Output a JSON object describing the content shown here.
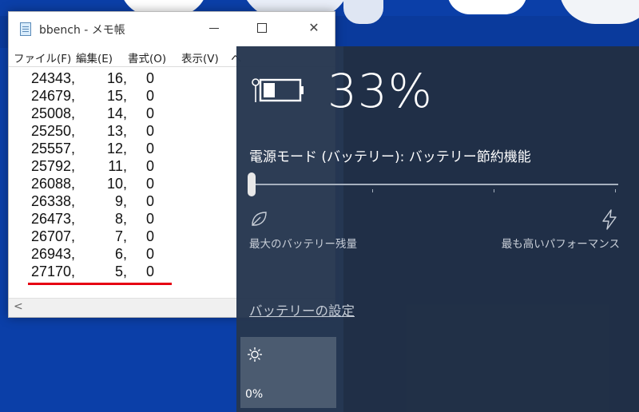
{
  "notepad": {
    "title": "bbench - メモ帳",
    "menu": [
      "ファイル(F)",
      "編集(E)",
      "書式(O)",
      "表示(V)",
      "ヘ"
    ],
    "rows": [
      [
        "24343,",
        "16,",
        "0"
      ],
      [
        "24679,",
        "15,",
        "0"
      ],
      [
        "25008,",
        "14,",
        "0"
      ],
      [
        "25250,",
        "13,",
        "0"
      ],
      [
        "25557,",
        "12,",
        "0"
      ],
      [
        "25792,",
        "11,",
        "0"
      ],
      [
        "26088,",
        "10,",
        "0"
      ],
      [
        "26338,",
        "9,",
        "0"
      ],
      [
        "26473,",
        "8,",
        "0"
      ],
      [
        "26707,",
        "7,",
        "0"
      ],
      [
        "26943,",
        "6,",
        "0"
      ],
      [
        "27170,",
        "5,",
        "0"
      ]
    ],
    "scroll_arrow": "<"
  },
  "battery": {
    "percent": "33%",
    "level": 0.33,
    "power_mode": "電源モード (バッテリー): バッテリー節約機能",
    "slider_value": 0,
    "label_left": "最大のバッテリー残量",
    "label_right": "最も高いパフォーマンス",
    "settings_link": "バッテリーの設定",
    "tile_value": "0%",
    "icons": [
      "battery-icon",
      "leaf-icon",
      "bolt-icon",
      "sun-icon"
    ]
  },
  "colors": {
    "underline": "#e60012",
    "flyout_bg": "#26374f",
    "desktop_bg": "#0b3fa8"
  }
}
